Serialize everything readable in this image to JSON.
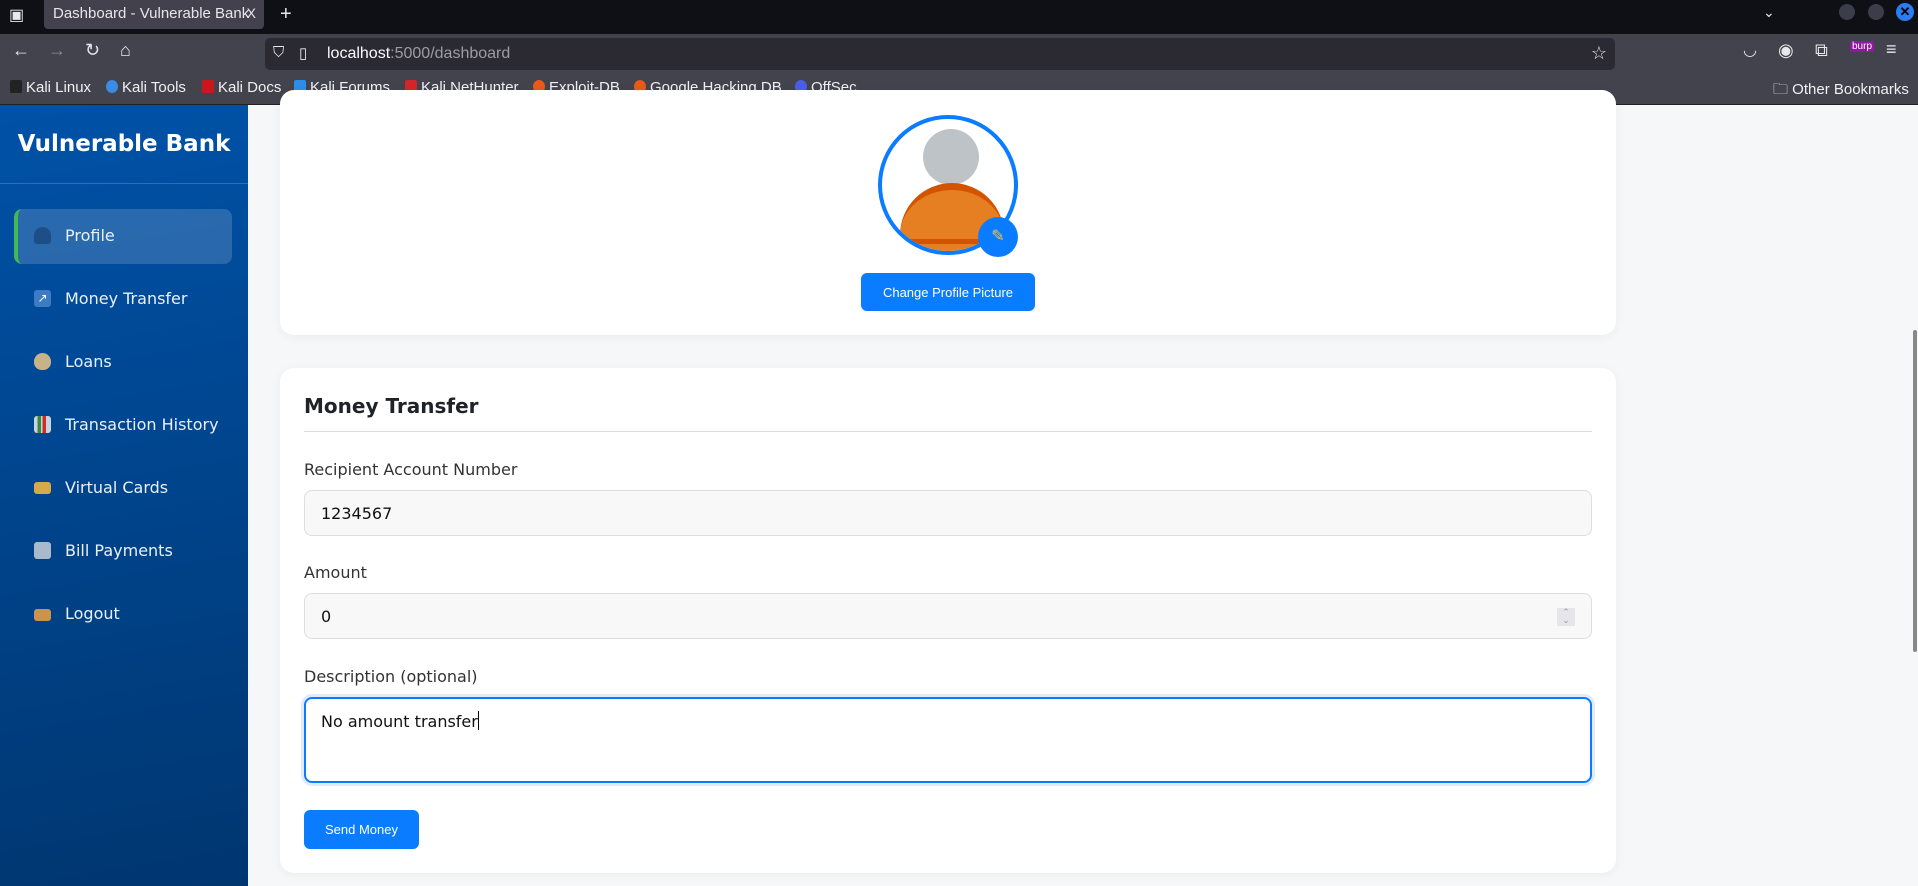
{
  "browser": {
    "tab_title": "Dashboard - Vulnerable Bank",
    "tab_close": "X",
    "new_tab": "+",
    "url_host": "localhost",
    "url_path": ":5000/dashboard",
    "bookmarks": [
      "Kali Linux",
      "Kali Tools",
      "Kali Docs",
      "Kali Forums",
      "Kali NetHunter",
      "Exploit-DB",
      "Google Hacking DB",
      "OffSec"
    ],
    "other_bookmarks": "Other Bookmarks",
    "burp_label": "burp"
  },
  "sidebar": {
    "brand": "Vulnerable Bank",
    "items": [
      {
        "label": "Profile",
        "icon": "user-icon",
        "active": true
      },
      {
        "label": "Money Transfer",
        "icon": "arrow-up-right-icon"
      },
      {
        "label": "Loans",
        "icon": "money-bag-icon"
      },
      {
        "label": "Transaction History",
        "icon": "bar-chart-icon"
      },
      {
        "label": "Virtual Cards",
        "icon": "credit-card-icon"
      },
      {
        "label": "Bill Payments",
        "icon": "receipt-icon"
      },
      {
        "label": "Logout",
        "icon": "lock-icon"
      }
    ]
  },
  "profile": {
    "change_picture": "Change Profile Picture"
  },
  "transfer": {
    "title": "Money Transfer",
    "recipient_label": "Recipient Account Number",
    "recipient_value": "1234567",
    "amount_label": "Amount",
    "amount_value": "0",
    "description_label": "Description (optional)",
    "description_value": "No amount transfer",
    "submit": "Send Money"
  },
  "colors": {
    "accent": "#0a7cff",
    "sidebar": "#0052a8",
    "active_marker": "#3fb950"
  }
}
